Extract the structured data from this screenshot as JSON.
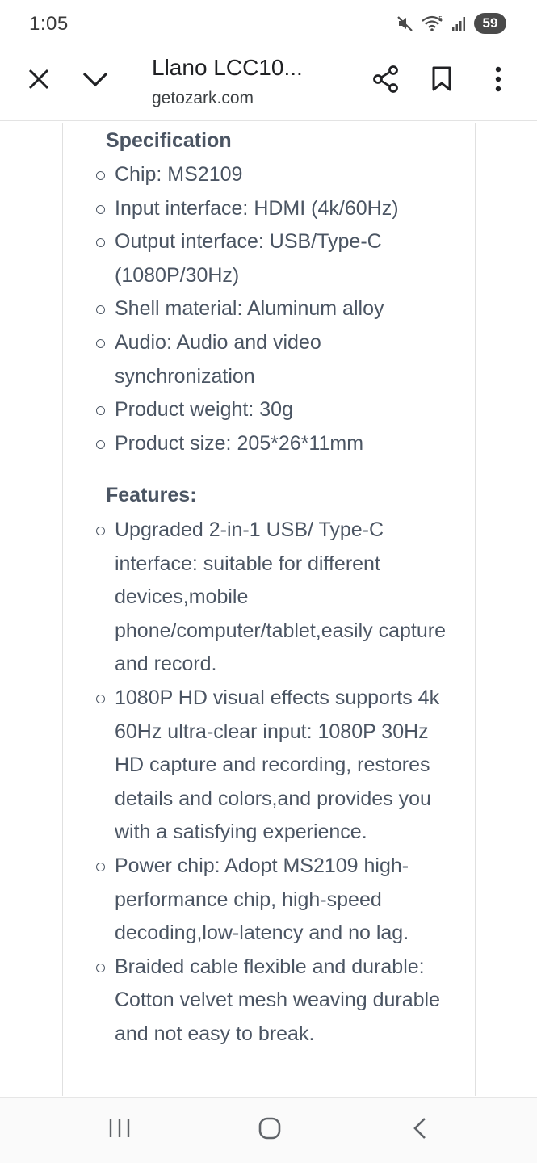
{
  "status_bar": {
    "time": "1:05",
    "battery": "59",
    "icons": [
      "mute-icon",
      "wifi-icon",
      "signal-icon"
    ]
  },
  "toolbar": {
    "title": "Llano LCC10...",
    "domain": "getozark.com",
    "icons": [
      "close-icon",
      "chevron-down-icon",
      "share-icon",
      "bookmark-icon",
      "more-vert-icon"
    ]
  },
  "content": {
    "specification": {
      "heading": "Specification",
      "items": [
        "Chip: MS2109",
        "Input interface: HDMI (4k/60Hz)",
        "Output interface: USB/Type-C (1080P/30Hz)",
        "Shell material: Aluminum alloy",
        "Audio: Audio and video synchronization",
        "Product weight: 30g",
        "Product size: 205*26*11mm"
      ]
    },
    "features": {
      "heading": "Features:",
      "items": [
        "Upgraded 2-in-1 USB/ Type-C interface: suitable for different devices,mobile phone/computer/tablet,easily capture and record.",
        "1080P HD visual effects supports 4k 60Hz ultra-clear input: 1080P 30Hz HD capture and recording, restores details and colors,and provides you with a satisfying experience.",
        "Power chip: Adopt MS2109 high-performance chip, high-speed decoding,low-latency and no lag.",
        "Braided cable flexible and durable: Cotton velvet mesh weaving durable and not easy to break."
      ]
    }
  },
  "navbar": {
    "icons": [
      "recents-icon",
      "home-icon",
      "back-icon"
    ]
  }
}
